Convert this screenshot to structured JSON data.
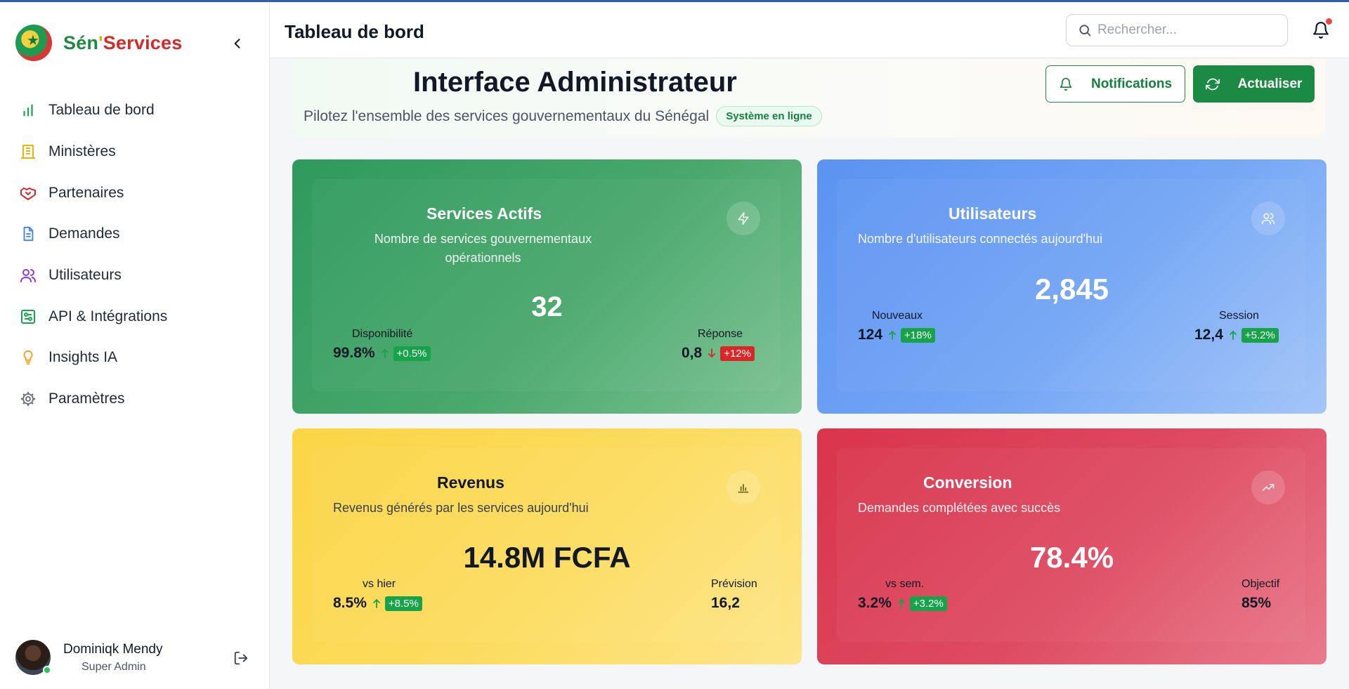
{
  "brand": {
    "p1": "Sén",
    "p2": "'",
    "p3": "Services"
  },
  "sidebar": {
    "items": [
      {
        "label": "Tableau de bord",
        "icon": "bar-chart-icon",
        "color": "#16a34a"
      },
      {
        "label": "Ministères",
        "icon": "building-icon",
        "color": "#eab308"
      },
      {
        "label": "Partenaires",
        "icon": "handshake-icon",
        "color": "#dc2626"
      },
      {
        "label": "Demandes",
        "icon": "document-icon",
        "color": "#3b82f6"
      },
      {
        "label": "Utilisateurs",
        "icon": "users-icon",
        "color": "#9333ea"
      },
      {
        "label": "API & Intégrations",
        "icon": "integration-icon",
        "color": "#16a34a"
      },
      {
        "label": "Insights IA",
        "icon": "lightbulb-icon",
        "color": "#f59e0b"
      },
      {
        "label": "Paramètres",
        "icon": "gear-icon",
        "color": "#6b7280"
      }
    ]
  },
  "user": {
    "name": "Dominiqk Mendy",
    "role": "Super Admin"
  },
  "header": {
    "title": "Tableau de bord",
    "search_placeholder": "Rechercher..."
  },
  "hero": {
    "title": "Interface Administrateur",
    "subtitle": "Pilotez l'ensemble des services gouvernementaux du Sénégal",
    "status": "Système en ligne",
    "btn_notifications": "Notifications",
    "btn_refresh": "Actualiser"
  },
  "cards": {
    "services": {
      "title": "Services Actifs",
      "desc": "Nombre de services gouvernementaux opérationnels",
      "value": "32",
      "left": {
        "label": "Disponibilité",
        "value": "99.8%",
        "delta": "+0.5%",
        "trend": "up"
      },
      "right": {
        "label": "Réponse",
        "value": "0,8",
        "delta": "+12%",
        "trend": "down"
      }
    },
    "users": {
      "title": "Utilisateurs",
      "desc": "Nombre d'utilisateurs connectés aujourd'hui",
      "value": "2,845",
      "left": {
        "label": "Nouveaux",
        "value": "124",
        "delta": "+18%",
        "trend": "up"
      },
      "right": {
        "label": "Session",
        "value": "12,4",
        "delta": "+5.2%",
        "trend": "up"
      }
    },
    "revenue": {
      "title": "Revenus",
      "desc": "Revenus générés par les services aujourd'hui",
      "value": "14.8M FCFA",
      "left": {
        "label": "vs hier",
        "value": "8.5%",
        "delta": "+8.5%",
        "trend": "up"
      },
      "right": {
        "label": "Prévision",
        "value": "16,2"
      }
    },
    "conversion": {
      "title": "Conversion",
      "desc": "Demandes complétées avec succès",
      "value": "78.4%",
      "left": {
        "label": "vs sem.",
        "value": "3.2%",
        "delta": "+3.2%",
        "trend": "up"
      },
      "right": {
        "label": "Objectif",
        "value": "85%"
      }
    }
  }
}
